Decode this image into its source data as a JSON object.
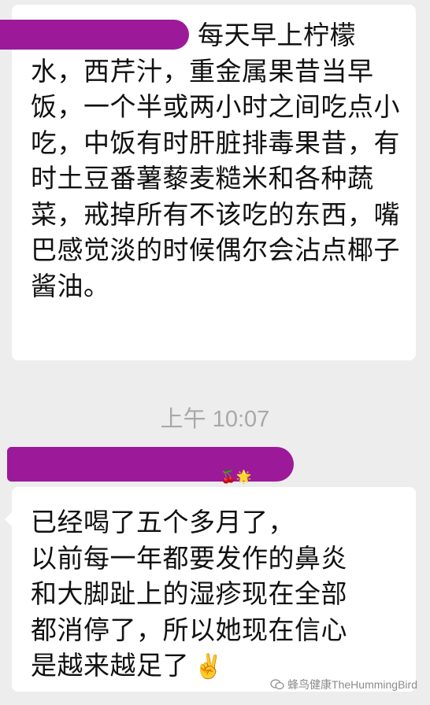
{
  "messages": [
    {
      "text": "每天早上柠檬水，西芹汁，重金属果昔当早饭，一个半或两小时之间吃点小吃，中饭有时肝脏排毒果昔，有时土豆番薯藜麦糙米和各种蔬菜，戒掉所有不该吃的东西，嘴巴感觉淡的时候偶尔会沾点椰子酱油。"
    },
    {
      "lines": [
        "已经喝了五个多月了，",
        "以前每一年都要发作的鼻炎",
        "和大脚趾上的湿疹现在全部",
        "都消停了，所以她现在信心",
        "是越来越足了"
      ],
      "emoji": "✌️"
    }
  ],
  "timestamp": "上午 10:07",
  "watermark": "蜂鸟健康TheHummingBird",
  "colors": {
    "background": "#ededed",
    "bubble": "#ffffff",
    "redaction": "#9c1a9a",
    "timestamp": "#a8a8a8"
  }
}
